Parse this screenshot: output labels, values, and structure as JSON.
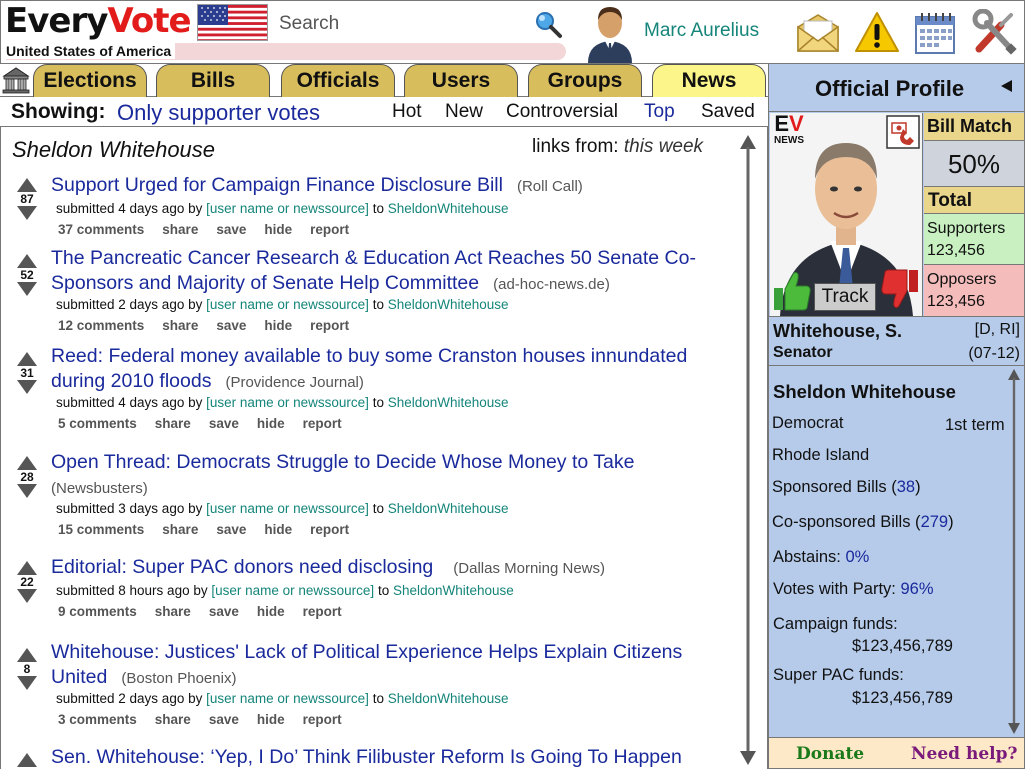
{
  "header": {
    "logo_part1": "Every",
    "logo_part2": "Vote",
    "country": "United States of America",
    "search_placeholder": "Search",
    "username": "Marc Aurelius",
    "icons": [
      "flag-icon",
      "search-icon",
      "avatar-icon",
      "mail-icon",
      "alert-icon",
      "calendar-icon",
      "settings-icon"
    ]
  },
  "tabs": [
    {
      "label": "Elections",
      "active": false
    },
    {
      "label": "Bills",
      "active": false
    },
    {
      "label": "Officials",
      "active": false
    },
    {
      "label": "Users",
      "active": false
    },
    {
      "label": "Groups",
      "active": false
    },
    {
      "label": "News",
      "active": true
    }
  ],
  "showing": {
    "label": "Showing",
    "value": "Only supporter votes",
    "sorts": [
      {
        "label": "Hot",
        "active": false
      },
      {
        "label": "New",
        "active": false
      },
      {
        "label": "Controversial",
        "active": false
      },
      {
        "label": "Top",
        "active": true
      },
      {
        "label": "Saved",
        "active": false
      }
    ]
  },
  "feed": {
    "title": "Sheldon Whitehouse",
    "links_from_label": "links from:",
    "links_from_value": "this week",
    "stories": [
      {
        "score": "87",
        "title": "Support Urged for Campaign Finance Disclosure Bill",
        "source": "(Roll Call)",
        "time": "submitted 4 days ago by",
        "user": "[user name or newssource]",
        "to": "to",
        "target": "SheldonWhitehouse",
        "comments": "37 comments",
        "share": "share",
        "save": "save",
        "hide": "hide",
        "report": "report"
      },
      {
        "score": "52",
        "title": "The Pancreatic Cancer Research & Education Act Reaches 50 Senate Co-Sponsors and Majority of Senate Help Committee",
        "source": "(ad-hoc-news.de)",
        "time": "submitted 2 days ago by",
        "user": "[user name or newssource]",
        "to": "to",
        "target": "SheldonWhitehouse",
        "comments": "12 comments",
        "share": "share",
        "save": "save",
        "hide": "hide",
        "report": "report"
      },
      {
        "score": "31",
        "title": "Reed: Federal money available to buy some Cranston houses innundated during 2010 floods",
        "source": "(Providence Journal)",
        "time": "submitted 4 days ago by",
        "user": "[user name or newssource]",
        "to": "to",
        "target": "SheldonWhitehouse",
        "comments": "5 comments",
        "share": "share",
        "save": "save",
        "hide": "hide",
        "report": "report"
      },
      {
        "score": "28",
        "title": "Open Thread: Democrats Struggle to Decide Whose Money to Take",
        "source": "(Newsbusters)",
        "time": "submitted 3 days ago by",
        "user": "[user name or newssource]",
        "to": "to",
        "target": "SheldonWhitehouse",
        "comments": "15 comments",
        "share": "share",
        "save": "save",
        "hide": "hide",
        "report": "report"
      },
      {
        "score": "22",
        "title": "Editorial: Super PAC donors need disclosing",
        "source": "(Dallas Morning News)",
        "time": "submitted 8 hours ago by",
        "user": "[user name or newssource]",
        "to": "to",
        "target": "SheldonWhitehouse",
        "comments": "9 comments",
        "share": "share",
        "save": "save",
        "hide": "hide",
        "report": "report"
      },
      {
        "score": "8",
        "title": "Whitehouse: Justices' Lack of Political Experience Helps Explain Citizens United",
        "source": "(Boston Phoenix)",
        "time": "submitted 2 days ago by",
        "user": "[user name or newssource]",
        "to": "to",
        "target": "SheldonWhitehouse",
        "comments": "3 comments",
        "share": "share",
        "save": "save",
        "hide": "hide",
        "report": "report"
      },
      {
        "score": "",
        "title": "Sen. Whitehouse: ‘Yep, I Do’ Think Filibuster Reform Is Going To Happen",
        "source": "",
        "time": "",
        "user": "",
        "to": "",
        "target": "",
        "comments": "",
        "share": "",
        "save": "",
        "hide": "",
        "report": ""
      }
    ]
  },
  "profile": {
    "title": "Official Profile",
    "badge_e": "E",
    "badge_v": "V",
    "badge_news": "NEWS",
    "track": "Track",
    "bill_match_label": "Bill Match",
    "bill_match_value": "50%",
    "total_label": "Total",
    "supporters_label": "Supporters",
    "supporters_count": "123,456",
    "opposers_label": "Opposers",
    "opposers_count": "123,456",
    "short_name": "Whitehouse, S.",
    "party_state": "[D, RI]",
    "role": "Senator",
    "years": "(07-12)",
    "full_name": "Sheldon Whitehouse",
    "party": "Democrat",
    "term": "1st term",
    "state": "Rhode Island",
    "sponsored_label": "Sponsored Bills (",
    "sponsored_count": "38",
    "cosponsored_label": "Co-sponsored Bills (",
    "cosponsored_count": "279",
    "close_paren": ")",
    "abstains_label": "Abstains:",
    "abstains_value": "0%",
    "votes_party_label": "Votes with Party:",
    "votes_party_value": "96%",
    "campaign_label": "Campaign funds:",
    "campaign_value": "$123,456,789",
    "superpac_label": "Super PAC funds:",
    "superpac_value": "$123,456,789"
  },
  "footer": {
    "donate": "Donate",
    "help": "Need help?"
  },
  "colors": {
    "accent_blue": "#1a2a9c",
    "teal": "#15857a",
    "tab_gold": "#d8bd5c",
    "tab_active": "#fcf58a",
    "panel_blue": "#b6cbea",
    "logo_red": "#e21b1b"
  }
}
